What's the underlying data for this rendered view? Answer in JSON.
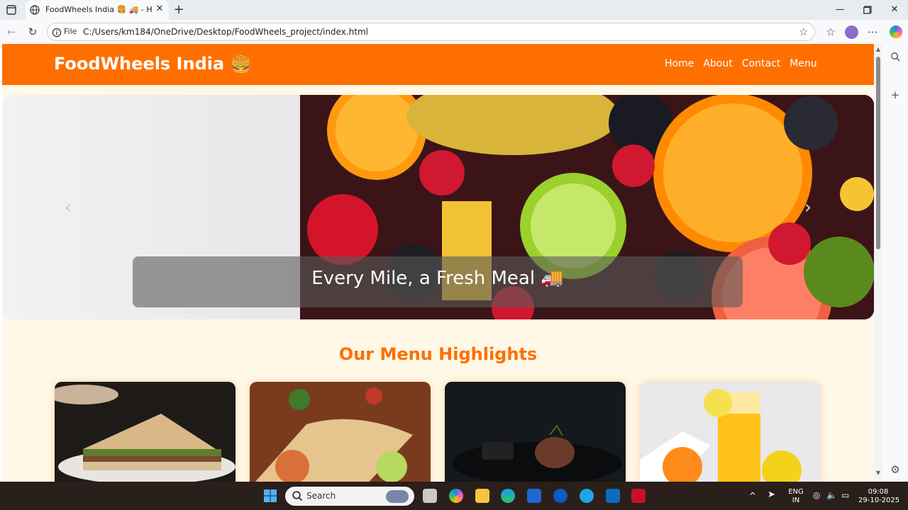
{
  "browser": {
    "tab_title": "FoodWheels India 🍔 🚚 - Home",
    "address_prefix": "File",
    "url": "C:/Users/km184/OneDrive/Desktop/FoodWheels_project/index.html"
  },
  "site": {
    "brand": "FoodWheels India 🍔",
    "nav": [
      {
        "label": "Home"
      },
      {
        "label": "About"
      },
      {
        "label": "Contact"
      },
      {
        "label": "Menu"
      }
    ],
    "hero_caption": "Every Mile, a Fresh Meal 🚚",
    "section_title": "Our Menu Highlights",
    "cards": [
      {
        "icon": "sandwich-image"
      },
      {
        "icon": "burrito-image"
      },
      {
        "icon": "steak-image"
      },
      {
        "icon": "orange-juice-image"
      }
    ]
  },
  "taskbar": {
    "search_label": "Search",
    "lang": "ENG",
    "region": "IN",
    "time": "09:08",
    "date": "29-10-2025"
  },
  "colors": {
    "brand_orange": "#ff6f00",
    "page_bg": "#fff8e7"
  }
}
